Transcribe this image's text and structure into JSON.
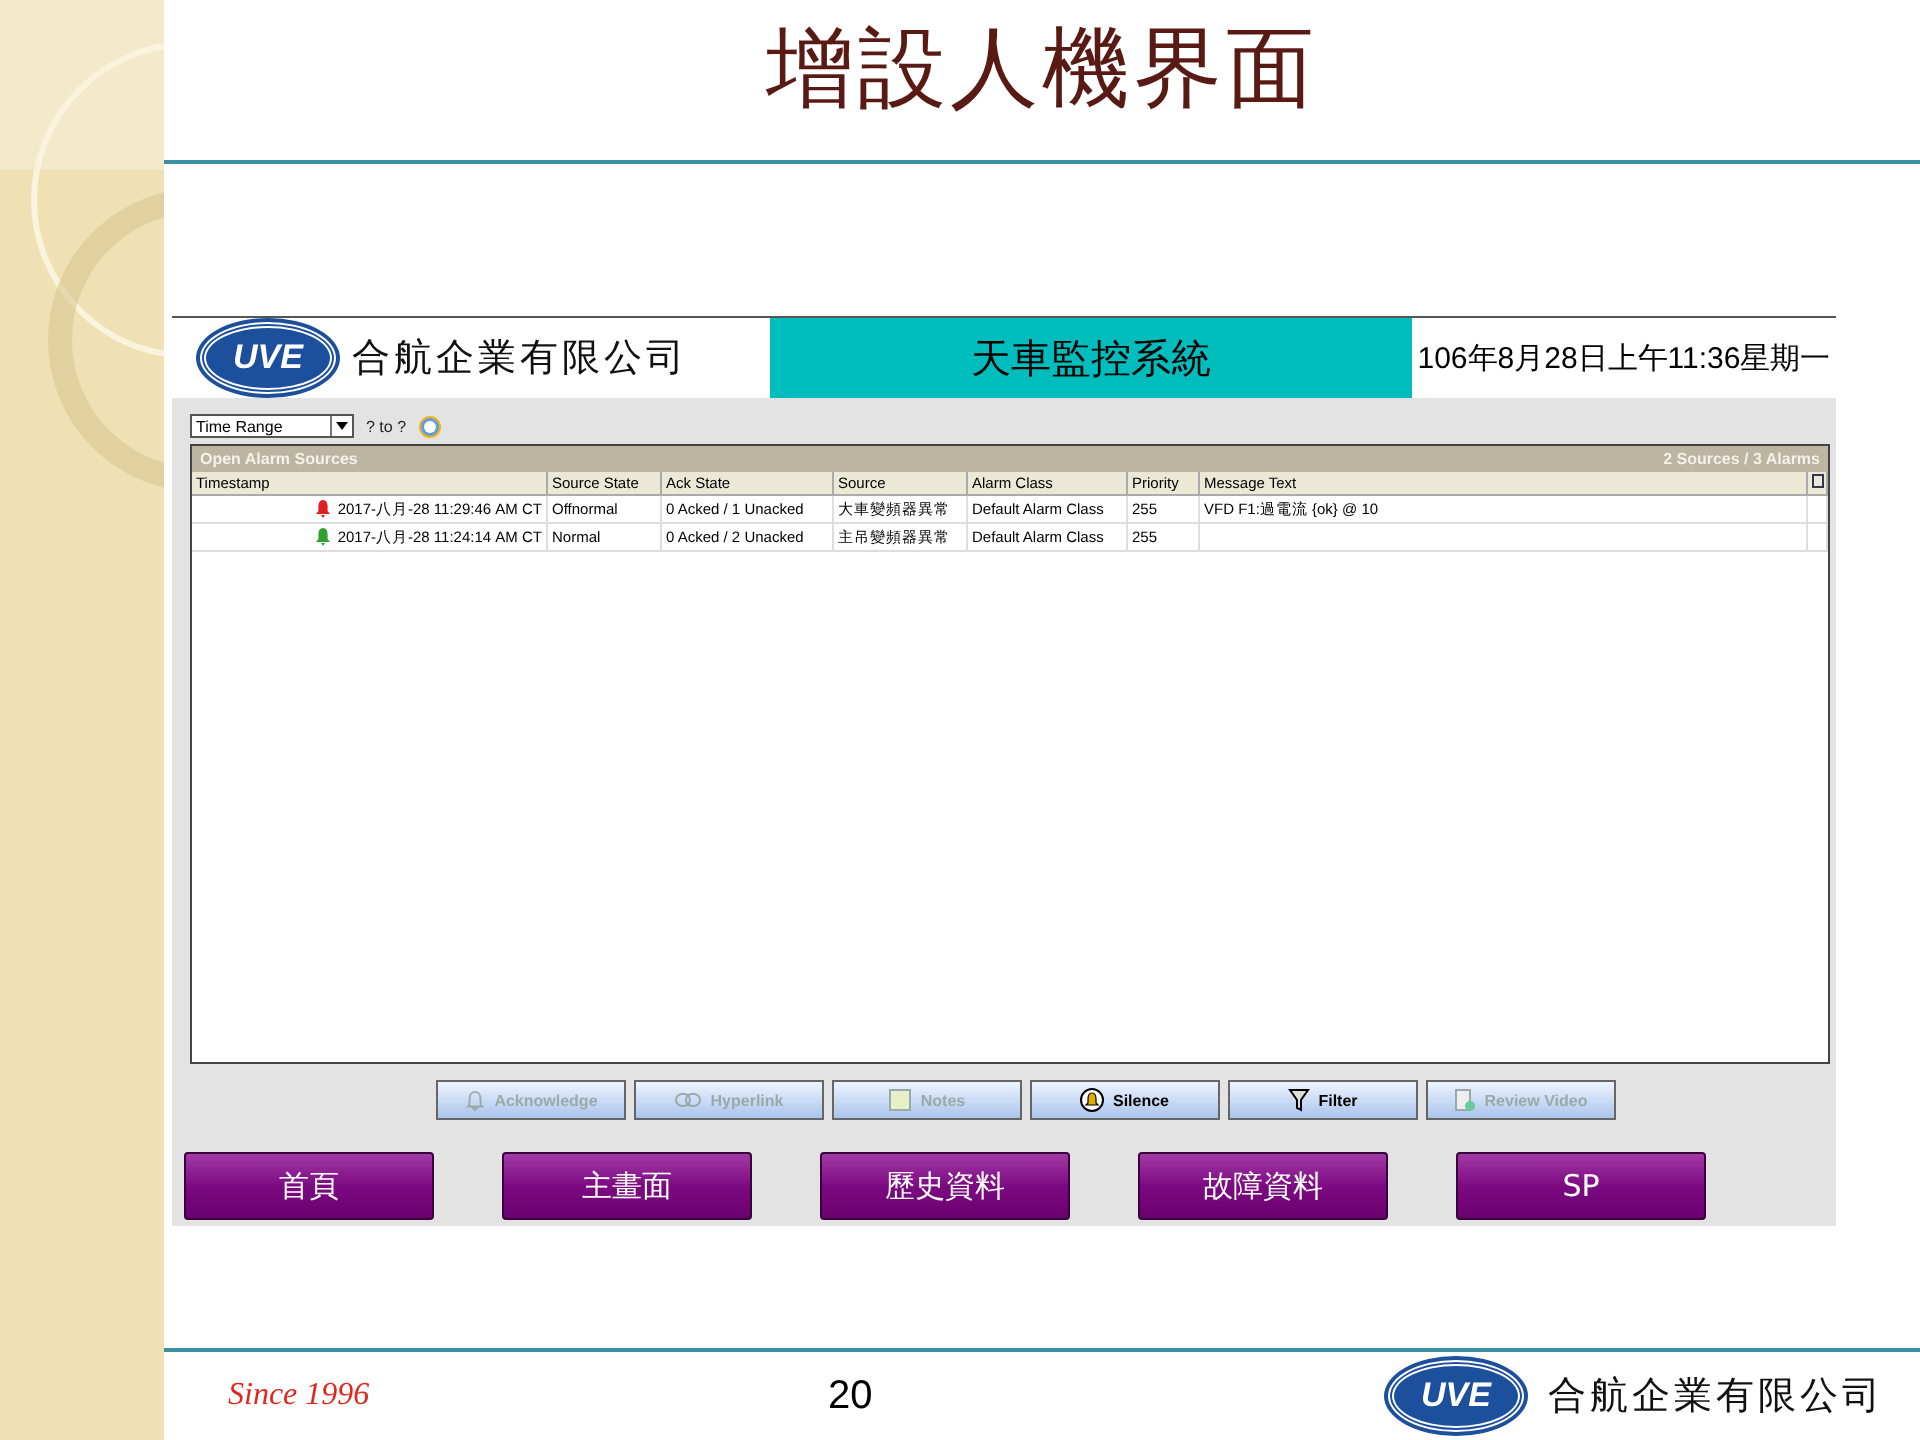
{
  "slide": {
    "title": "增設人機界面",
    "page_number": "20",
    "footer_tagline": "Since 1996",
    "footer_company": "合航企業有限公司",
    "footer_logo_text": "UVE"
  },
  "hmi": {
    "logo_text": "UVE",
    "company": "合航企業有限公司",
    "system_title": "天車監控系統",
    "datetime": "106年8月28日上午11:36星期一"
  },
  "filter_bar": {
    "range_select": "Time Range",
    "range_text": "? to ?"
  },
  "alarm_table": {
    "title": "Open Alarm Sources",
    "summary": "2 Sources / 3 Alarms",
    "columns": [
      "Timestamp",
      "Source State",
      "Ack State",
      "Source",
      "Alarm Class",
      "Priority",
      "Message Text"
    ],
    "rows": [
      {
        "color": "#e02020",
        "cells": [
          "2017-八月-28 11:29:46 AM CT",
          "Offnormal",
          "0 Acked / 1 Unacked",
          "大車變頻器異常",
          "Default Alarm Class",
          "255",
          "VFD F1:過電流 {ok} @ 10"
        ]
      },
      {
        "color": "#30a030",
        "cells": [
          "2017-八月-28 11:24:14 AM CT",
          "Normal",
          "0 Acked / 2 Unacked",
          "主吊變頻器異常",
          "Default Alarm Class",
          "255",
          ""
        ]
      }
    ]
  },
  "action_buttons": [
    {
      "label": "Acknowledge",
      "kind": "bell",
      "disabled": true
    },
    {
      "label": "Hyperlink",
      "kind": "link",
      "disabled": true
    },
    {
      "label": "Notes",
      "kind": "note",
      "disabled": true
    },
    {
      "label": "Silence",
      "kind": "silence",
      "disabled": false
    },
    {
      "label": "Filter",
      "kind": "filter",
      "disabled": false
    },
    {
      "label": "Review Video",
      "kind": "video",
      "disabled": true
    }
  ],
  "nav_buttons": [
    "首頁",
    "主畫面",
    "歷史資料",
    "故障資料",
    "SP"
  ]
}
